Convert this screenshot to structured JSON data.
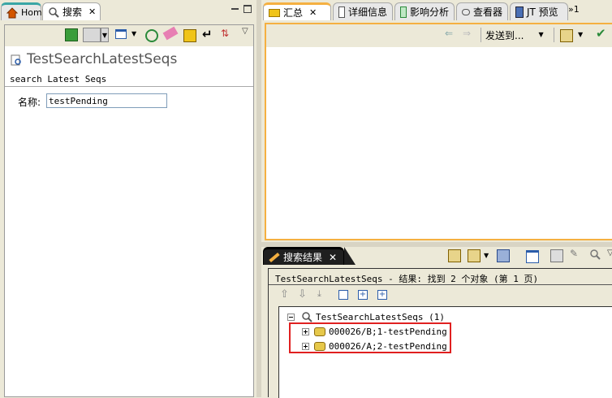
{
  "left": {
    "tabs": [
      {
        "label": "Home"
      },
      {
        "label": "搜索"
      }
    ],
    "title": "TestSearchLatestSeqs",
    "subtitle": "search Latest Seqs",
    "field_label": "名称:",
    "field_value": "testPending"
  },
  "right": {
    "tabs": [
      {
        "label": "汇总"
      },
      {
        "label": "详细信息"
      },
      {
        "label": "影响分析"
      },
      {
        "label": "查看器"
      },
      {
        "label": "JT 预览"
      },
      {
        "label": "»1"
      }
    ],
    "send_to": "发送到..."
  },
  "results": {
    "tab_label": "搜索结果",
    "summary": "TestSearchLatestSeqs - 结果: 找到 2 个对象 (第 1 页)",
    "root": "TestSearchLatestSeqs (1)",
    "items": [
      {
        "label": "000026/B;1-testPending"
      },
      {
        "label": "000026/A;2-testPending"
      }
    ]
  },
  "colors": {
    "highlight_box": "#e02020",
    "tab_accent": "#f5b041"
  }
}
